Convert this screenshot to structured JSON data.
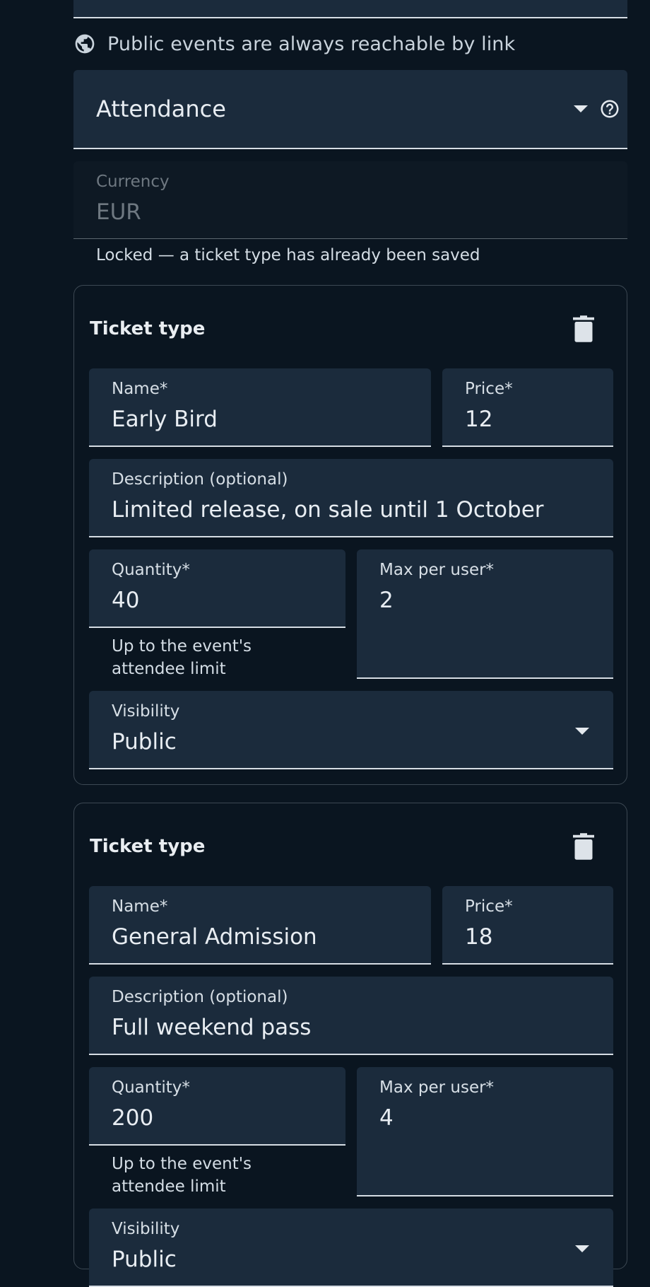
{
  "visibility_hint": {
    "icon": "globe-icon",
    "text": "Public events are always reachable by link"
  },
  "attendance_select": {
    "value": "Attendance",
    "dropdown_icon": "caret-down-icon",
    "help_icon": "help-circle-icon"
  },
  "currency": {
    "label": "Currency",
    "value": "EUR",
    "helper": "Locked — a ticket type has already been saved"
  },
  "ticket_types": [
    {
      "title": "Ticket type",
      "delete_icon": "trash-icon",
      "name_label": "Name*",
      "name_value": "Early Bird",
      "price_label": "Price*",
      "price_value": "12",
      "description_label": "Description (optional)",
      "description_value": "Limited release, on sale until 1 October",
      "quantity_label": "Quantity*",
      "quantity_value": "40",
      "quantity_helper_line1": "Up to the event's",
      "quantity_helper_line2": "attendee limit",
      "max_label": "Max per user*",
      "max_value": "2",
      "visibility_label": "Visibility",
      "visibility_value": "Public"
    },
    {
      "title": "Ticket type",
      "delete_icon": "trash-icon",
      "name_label": "Name*",
      "name_value": "General Admission",
      "price_label": "Price*",
      "price_value": "18",
      "description_label": "Description (optional)",
      "description_value": "Full weekend pass",
      "quantity_label": "Quantity*",
      "quantity_value": "200",
      "quantity_helper_line1": "Up to the event's",
      "quantity_helper_line2": "attendee limit",
      "max_label": "Max per user*",
      "max_value": "4",
      "visibility_label": "Visibility",
      "visibility_value": "Public"
    }
  ],
  "colors": {
    "page_background": "#0a1520",
    "field_background": "#1b2b3c",
    "disabled_field_background": "#0e1924",
    "underline": "#d6dde4",
    "card_border": "#3c4853",
    "text": "#e8edf2",
    "muted_text": "#6e7881"
  }
}
